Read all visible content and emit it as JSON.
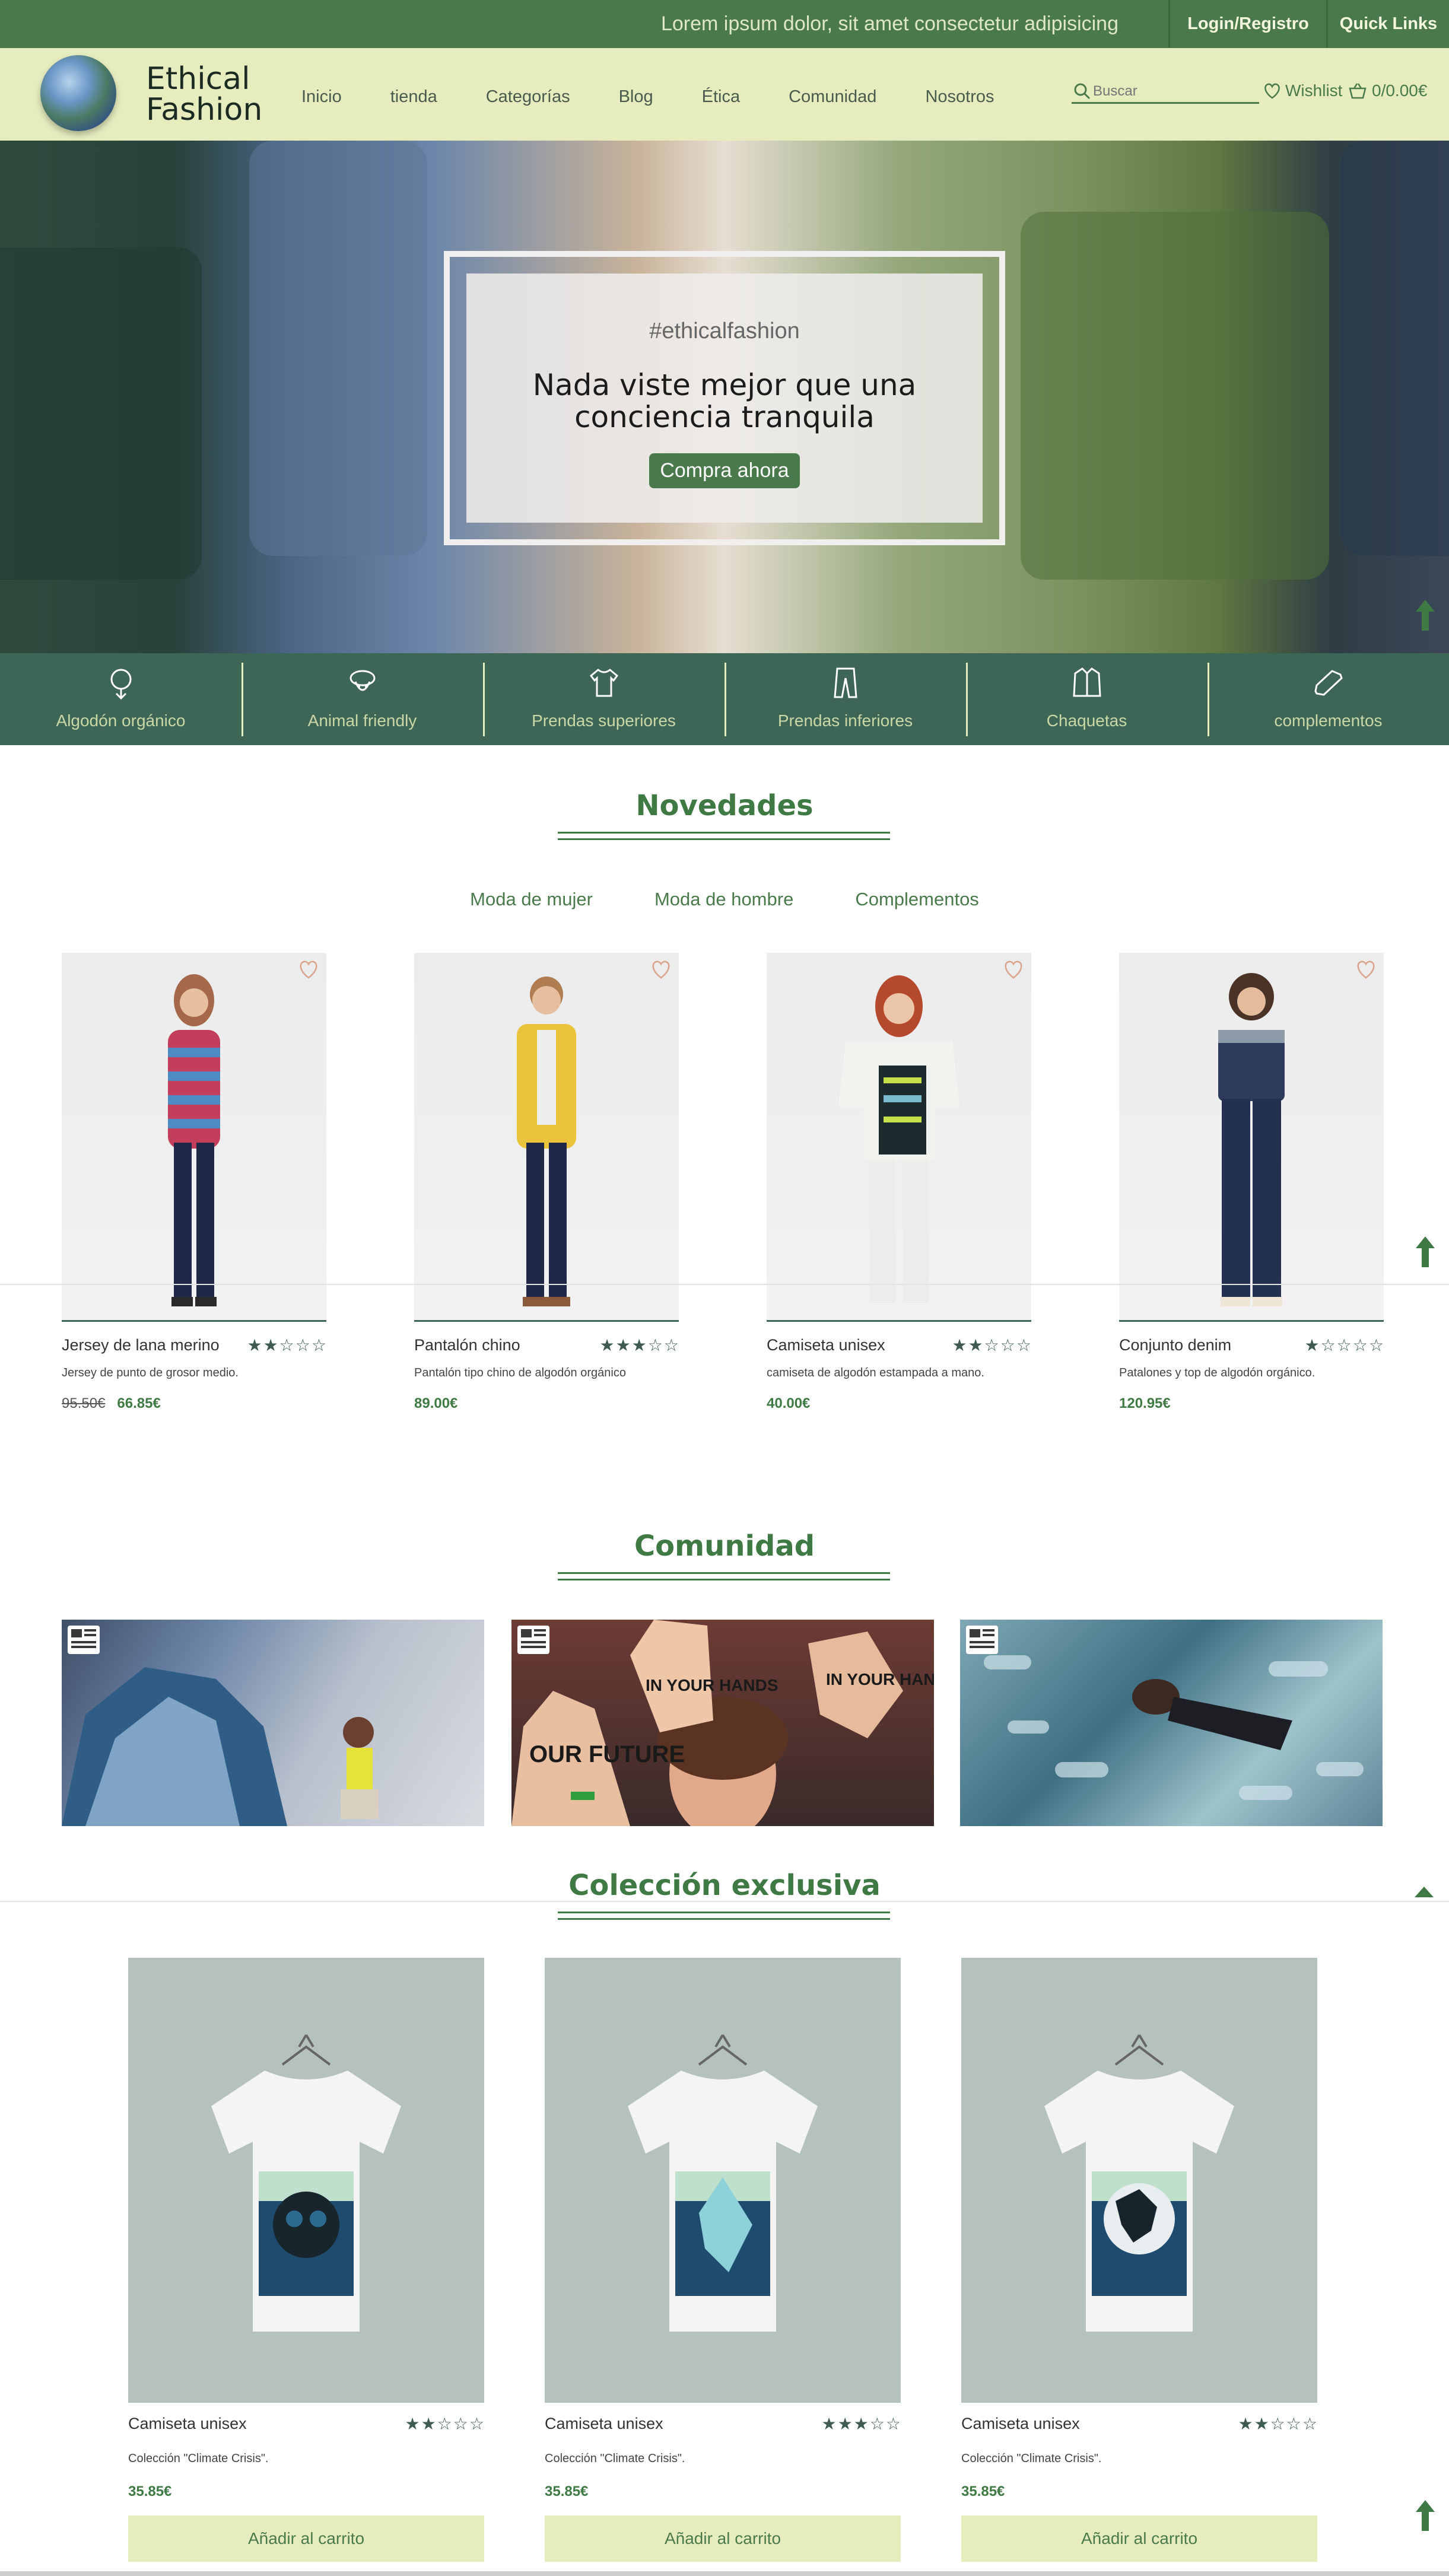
{
  "topbar": {
    "promo": "Lorem ipsum dolor, sit amet consectetur adipisicing",
    "login": "Login/Registro",
    "quick_links": "Quick Links"
  },
  "header": {
    "logo_line1": "Ethical",
    "logo_line2": "Fashion",
    "nav": [
      "Inicio",
      "tienda",
      "Categorías",
      "Blog",
      "Ética",
      "Comunidad",
      "Nosotros"
    ],
    "search_placeholder": "Buscar",
    "wishlist": "Wishlist",
    "cart": "0/0.00€"
  },
  "hero": {
    "tag": "#ethicalfashion",
    "title_line1": "Nada viste mejor que una",
    "title_line2": "conciencia tranquila",
    "cta": "Compra ahora"
  },
  "categories": [
    {
      "label": "Algodón orgánico",
      "icon": "cotton-icon"
    },
    {
      "label": "Animal friendly",
      "icon": "sheep-icon"
    },
    {
      "label": "Prendas superiores",
      "icon": "tshirt-icon"
    },
    {
      "label": "Prendas inferiores",
      "icon": "pants-icon"
    },
    {
      "label": "Chaquetas",
      "icon": "jacket-icon"
    },
    {
      "label": "complementos",
      "icon": "shoe-icon"
    }
  ],
  "novedades": {
    "title": "Novedades",
    "tabs": [
      "Moda de mujer",
      "Moda de hombre",
      "Complementos"
    ],
    "products": [
      {
        "name": "Jersey de lana merino",
        "rating": 2,
        "desc": "Jersey de punto de grosor medio.",
        "old_price": "95.50€",
        "price": "66.85€"
      },
      {
        "name": "Pantalón chino",
        "rating": 3,
        "desc": "Pantalón tipo chino de algodón orgánico",
        "old_price": "",
        "price": "89.00€"
      },
      {
        "name": "Camiseta unisex",
        "rating": 2,
        "desc": "camiseta de algodón estampada a mano.",
        "old_price": "",
        "price": "40.00€"
      },
      {
        "name": "Conjunto denim",
        "rating": 1,
        "desc": "Patalones y top de algodón orgánico.",
        "old_price": "",
        "price": "120.95€"
      }
    ]
  },
  "comunidad": {
    "title": "Comunidad",
    "posts": [
      {
        "icon": "newspaper-icon",
        "signs": []
      },
      {
        "icon": "newspaper-icon",
        "signs": [
          "OUR FUTURE",
          "IN YOUR HANDS",
          "IN YOUR HANDS"
        ]
      },
      {
        "icon": "newspaper-icon",
        "signs": []
      }
    ]
  },
  "exclusiva": {
    "title": "Colección exclusiva",
    "products": [
      {
        "name": "Camiseta unisex",
        "rating": 2,
        "desc": "Colección \"Climate Crisis\".",
        "price": "35.85€",
        "button": "Añadir al carrito"
      },
      {
        "name": "Camiseta unisex",
        "rating": 3,
        "desc": "Colección \"Climate Crisis\".",
        "price": "35.85€",
        "button": "Añadir al carrito"
      },
      {
        "name": "Camiseta unisex",
        "rating": 2,
        "desc": "Colección \"Climate Crisis\".",
        "price": "35.85€",
        "button": "Añadir al carrito"
      }
    ]
  },
  "colors": {
    "brand_green": "#4a7a4b",
    "header_bg": "#e6ecbe",
    "category_bg": "#3e6656",
    "title_green": "#3f7a44"
  }
}
